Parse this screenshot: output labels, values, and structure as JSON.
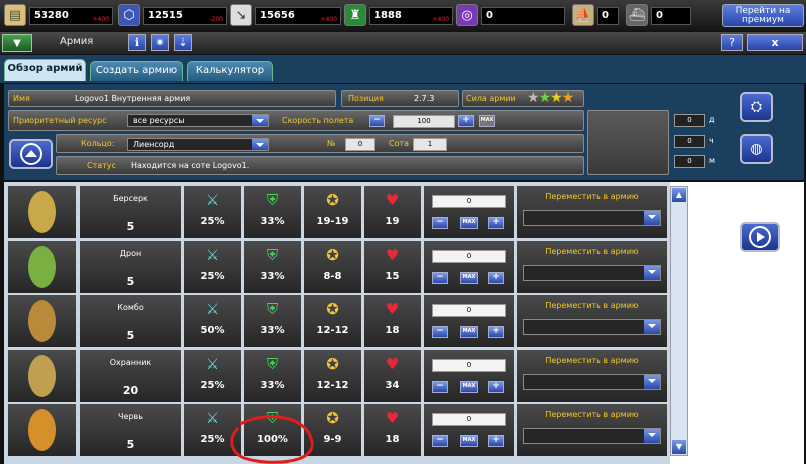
{
  "resources": [
    {
      "icon": "stone-icon",
      "value": "53280",
      "delta": "+400"
    },
    {
      "icon": "crystal-icon",
      "value": "12515",
      "delta": "-200"
    },
    {
      "icon": "bolt-icon",
      "value": "15656",
      "delta": "+400"
    },
    {
      "icon": "population-icon",
      "value": "1888",
      "delta": "+400"
    },
    {
      "icon": "target-icon",
      "value": "0",
      "delta": ""
    }
  ],
  "resources_right": [
    {
      "icon": "ship-icon",
      "value": "0"
    },
    {
      "icon": "ship2-icon",
      "value": "0"
    }
  ],
  "premium_label": "Перейти на премиум",
  "title": "Армия",
  "help_label": "?",
  "close_label": "x",
  "tabs": [
    "Обзор армий",
    "Создать армию",
    "Калькулятор"
  ],
  "info": {
    "name_label": "Имя",
    "name_value": "Logovo1 Внутренняя армия",
    "position_label": "Позиция",
    "position_value": "2.7.3",
    "strength_label": "Сила армии",
    "strength_stars": 4,
    "priority_label": "Приоритетный ресурс",
    "priority_value": "все ресурсы",
    "speed_label": "Скорость полета",
    "speed_value": "100",
    "speed_max": "MAX",
    "ring_label": "Кольцо:",
    "ring_value": "Лиенсорд",
    "no_label": "№",
    "no_value": "0",
    "cell_label": "Сота",
    "cell_value": "1",
    "status_label": "Статус",
    "status_value": "Находится на соте Logovo1.",
    "time": [
      {
        "value": "0",
        "unit": "д"
      },
      {
        "value": "0",
        "unit": "ч"
      },
      {
        "value": "0",
        "unit": "м"
      }
    ]
  },
  "move_label": "Переместить в армию",
  "units": [
    {
      "name": "Берсерк",
      "count": "5",
      "attack": "25%",
      "defense": "33%",
      "damage": "19-19",
      "health": "19",
      "amount": "0"
    },
    {
      "name": "Дрон",
      "count": "5",
      "attack": "25%",
      "defense": "33%",
      "damage": "8-8",
      "health": "15",
      "amount": "0"
    },
    {
      "name": "Комбо",
      "count": "5",
      "attack": "50%",
      "defense": "33%",
      "damage": "12-12",
      "health": "18",
      "amount": "0"
    },
    {
      "name": "Охранник",
      "count": "20",
      "attack": "25%",
      "defense": "33%",
      "damage": "12-12",
      "health": "34",
      "amount": "0"
    },
    {
      "name": "Червь",
      "count": "5",
      "attack": "25%",
      "defense": "100%",
      "damage": "9-9",
      "health": "18",
      "amount": "0"
    }
  ],
  "max_label": "MAX"
}
